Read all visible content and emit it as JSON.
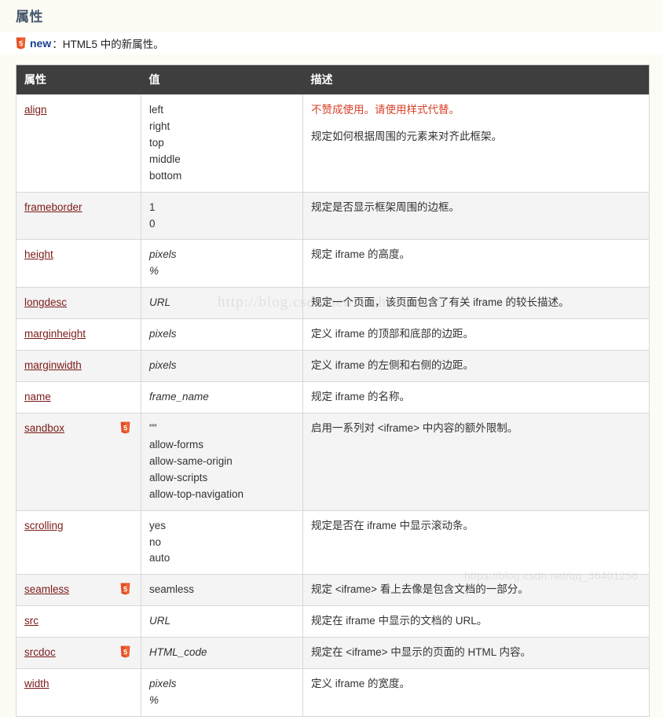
{
  "page": {
    "title": "属性",
    "background_color": "#fcfcf4",
    "title_color": "#44546a"
  },
  "note": {
    "badge_icon": "html5-badge-icon",
    "new_label": "new",
    "text": "：HTML5 中的新属性。",
    "new_color": "#1b3f94",
    "badge_color": "#e44d26"
  },
  "table": {
    "header_bg": "#3e3e3e",
    "link_color": "#7b1a1a",
    "deprecated_color": "#d8432b",
    "columns": [
      "属性",
      "值",
      "描述"
    ],
    "rows": [
      {
        "attr": "align",
        "html5": false,
        "value": "left\nright\ntop\nmiddle\nbottom",
        "value_italic": false,
        "desc_deprecated": "不赞成使用。请使用样式代替。",
        "desc": "规定如何根据周围的元素来对齐此框架。"
      },
      {
        "attr": "frameborder",
        "html5": false,
        "value": "1\n0",
        "value_italic": false,
        "desc_deprecated": "",
        "desc": "规定是否显示框架周围的边框。"
      },
      {
        "attr": "height",
        "html5": false,
        "value": "pixels\n%",
        "value_italic": true,
        "desc_deprecated": "",
        "desc": "规定 iframe 的高度。"
      },
      {
        "attr": "longdesc",
        "html5": false,
        "value": "URL",
        "value_italic": true,
        "desc_deprecated": "",
        "desc": "规定一个页面，该页面包含了有关 iframe 的较长描述。"
      },
      {
        "attr": "marginheight",
        "html5": false,
        "value": "pixels",
        "value_italic": true,
        "desc_deprecated": "",
        "desc": "定义 iframe 的顶部和底部的边距。"
      },
      {
        "attr": "marginwidth",
        "html5": false,
        "value": "pixels",
        "value_italic": true,
        "desc_deprecated": "",
        "desc": "定义 iframe 的左侧和右侧的边距。"
      },
      {
        "attr": "name",
        "html5": false,
        "value": "frame_name",
        "value_italic": true,
        "desc_deprecated": "",
        "desc": "规定 iframe 的名称。"
      },
      {
        "attr": "sandbox",
        "html5": true,
        "value": "\"\"\nallow-forms\nallow-same-origin\nallow-scripts\nallow-top-navigation",
        "value_italic": false,
        "desc_deprecated": "",
        "desc": "启用一系列对 <iframe> 中内容的额外限制。"
      },
      {
        "attr": "scrolling",
        "html5": false,
        "value": "yes\nno\nauto",
        "value_italic": false,
        "desc_deprecated": "",
        "desc": "规定是否在 iframe 中显示滚动条。"
      },
      {
        "attr": "seamless",
        "html5": true,
        "value": "seamless",
        "value_italic": false,
        "desc_deprecated": "",
        "desc": "规定 <iframe> 看上去像是包含文档的一部分。"
      },
      {
        "attr": "src",
        "html5": false,
        "value": "URL",
        "value_italic": true,
        "desc_deprecated": "",
        "desc": "规定在 iframe 中显示的文档的 URL。"
      },
      {
        "attr": "srcdoc",
        "html5": true,
        "value": "HTML_code",
        "value_italic": true,
        "desc_deprecated": "",
        "desc": "规定在 <iframe> 中显示的页面的 HTML 内容。"
      },
      {
        "attr": "width",
        "html5": false,
        "value": "pixels\n%",
        "value_italic": true,
        "desc_deprecated": "",
        "desc": "定义 iframe 的宽度。"
      }
    ]
  },
  "watermarks": {
    "middle": "http://blog.csdn.net/micheng-p",
    "bottom": "https://blog.csdn.net/qq_36401256"
  }
}
